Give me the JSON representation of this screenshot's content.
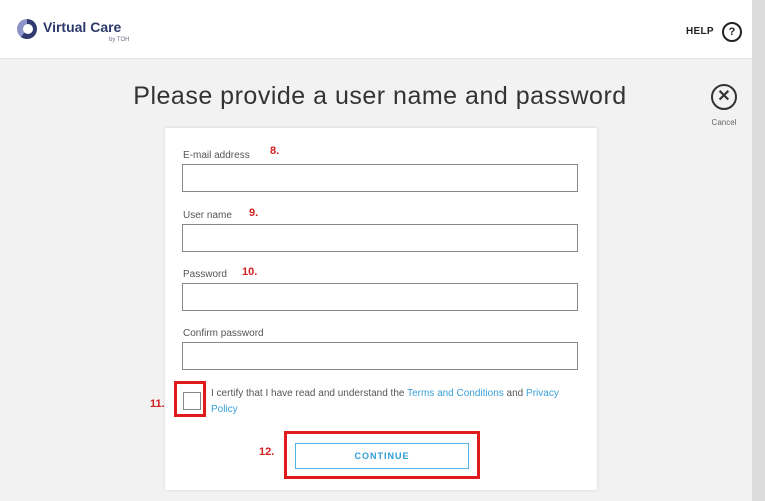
{
  "header": {
    "brand_title": "Virtual Care",
    "brand_subtitle": "by TOH",
    "help_label": "HELP",
    "help_icon": "question-circle-icon"
  },
  "page": {
    "title": "Please provide a user name and password",
    "cancel_label": "Cancel",
    "cancel_icon": "close-circle-icon"
  },
  "form": {
    "email": {
      "label": "E-mail address",
      "value": "",
      "placeholder": "",
      "marker": "8."
    },
    "username": {
      "label": "User name",
      "value": "",
      "placeholder": "",
      "marker": "9."
    },
    "password": {
      "label": "Password",
      "value": "",
      "placeholder": "",
      "marker": "10."
    },
    "confirm": {
      "label": "Confirm password",
      "value": "",
      "placeholder": ""
    },
    "certify": {
      "marker": "11.",
      "checked": false,
      "text_before": "I certify that I have read and understand the ",
      "terms_link": "Terms and Conditions",
      "text_between": " and ",
      "privacy_link": "Privacy Policy"
    },
    "continue": {
      "marker": "12.",
      "label": "CONTINUE"
    }
  },
  "colors": {
    "annotation_red": "#e01b1b",
    "link_blue": "#3a9fd8",
    "brand_navy": "#2b3a6b"
  }
}
